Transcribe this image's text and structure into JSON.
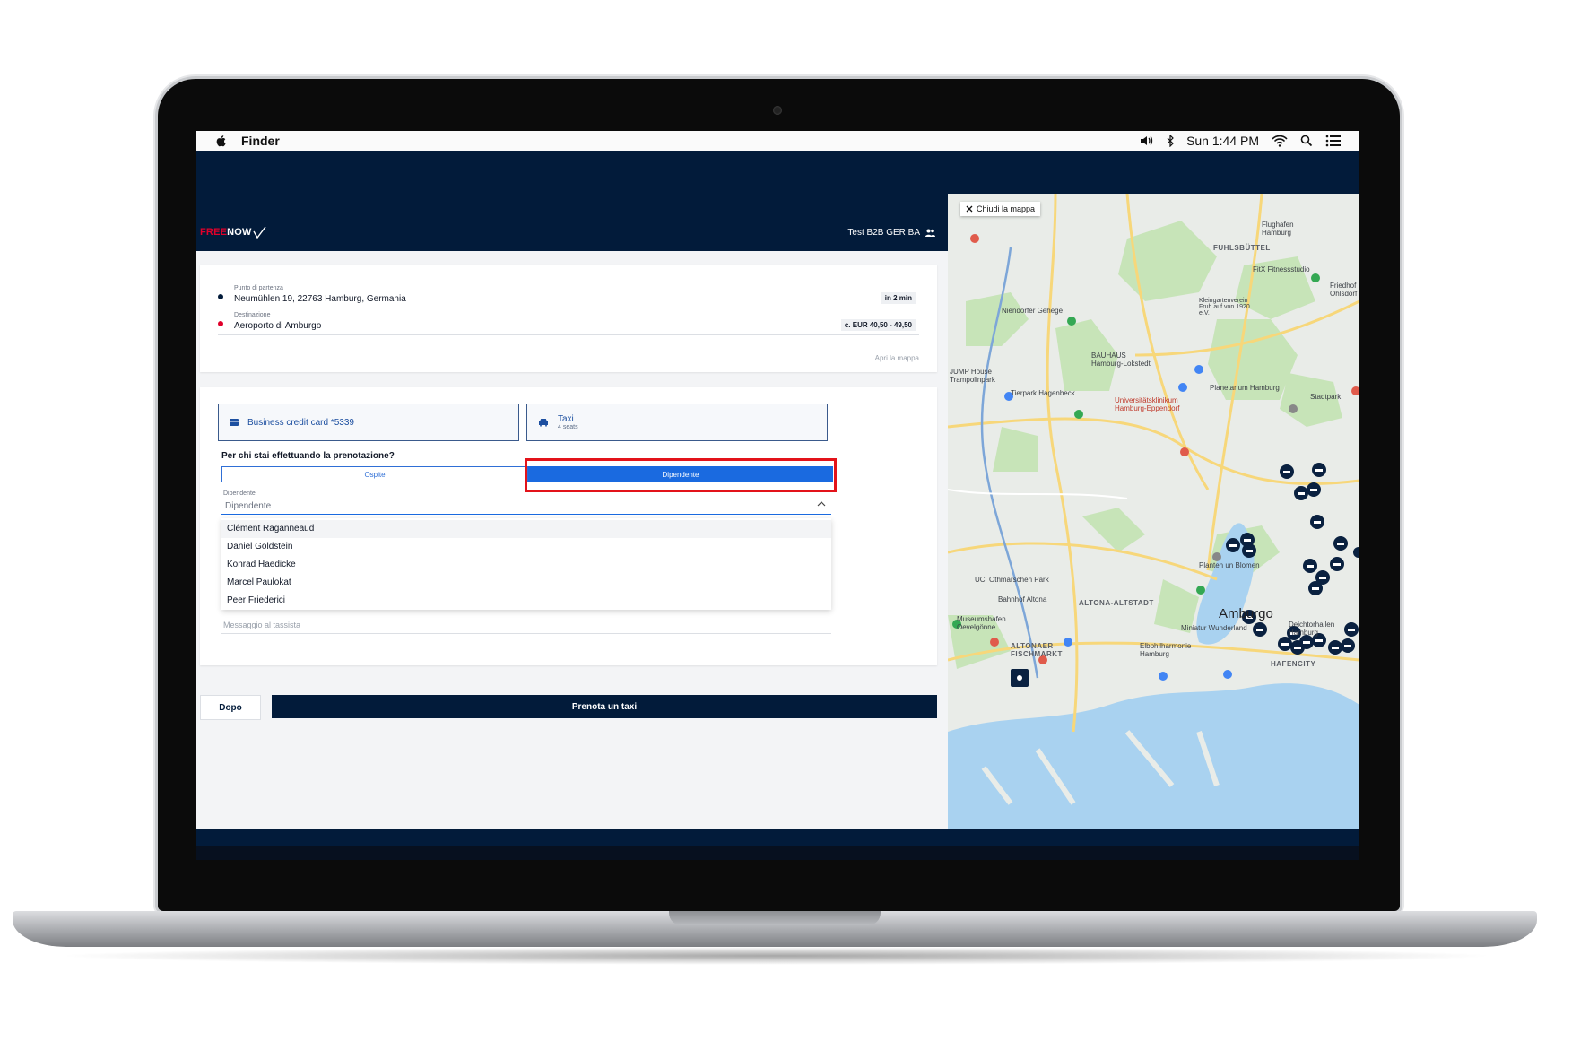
{
  "menubar": {
    "app": "Finder",
    "clock": "Sun 1:44 PM",
    "icons": [
      "apple-icon",
      "volume-icon",
      "bluetooth-icon",
      "wifi-icon",
      "search-icon",
      "list-icon"
    ]
  },
  "header": {
    "brand_free": "FREE",
    "brand_now": "NOW",
    "account": "Test B2B GER BA"
  },
  "route": {
    "pickup_label": "Punto di partenza",
    "pickup_value": "Neumühlen 19, 22763 Hamburg, Germania",
    "pickup_eta": "in 2 min",
    "dest_label": "Destinazione",
    "dest_value": "Aeroporto di Amburgo",
    "dest_price": "c. EUR 40,50 - 49,50",
    "open_map": "Apri la mappa"
  },
  "options": {
    "payment": "Business credit card *5339",
    "vehicle": "Taxi",
    "vehicle_seats": "4 seats",
    "question": "Per chi stai effettuando la prenotazione?",
    "segment_guest": "Ospite",
    "segment_employee": "Dipendente",
    "dropdown_label": "Dipendente",
    "dropdown_value": "Dipendente",
    "employees": [
      "Clément Raganneaud",
      "Daniel Goldstein",
      "Konrad Haedicke",
      "Marcel Paulokat",
      "Peer Friederici"
    ],
    "message_placeholder": "Messaggio al tassista"
  },
  "actions": {
    "later": "Dopo",
    "book": "Prenota un taxi"
  },
  "map": {
    "close": "Chiudi la mappa",
    "labels": {
      "fuhlsbuttel": "FUHLSBÜTTEL",
      "airport": "Flughafen Hamburg",
      "altona": "ALTONA-ALTSTADT",
      "city": "Amburgo",
      "hafencity": "HAFENCITY",
      "fischmarkt": "ALTONAER FISCHMARKT",
      "bauhaus": "BAUHAUS Hamburg-Lokstedt",
      "uke": "Universitätsklinikum Hamburg-Eppendorf",
      "hagenbeck": "Tierpark Hagenbeck",
      "niendorf": "Niendorfer Gehege",
      "planetarium": "Planetarium Hamburg",
      "stadtpark": "Stadtpark",
      "friedhof": "Friedhof Ohlsdorf",
      "fitx": "FitX Fitnessstudio",
      "elbphil": "Elbphilharmonie Hamburg",
      "miniatur": "Miniatur Wunderland",
      "dockhallen": "Deichtorhallen Hamburg",
      "planten": "Planten un Blomen",
      "othmarschen": "UCI Othmarschen Park",
      "museumshafen": "Museumshafen Oevelgönne",
      "bahnhof": "Bahnhof Altona",
      "jump": "JUMP House Trampolinpark",
      "kleingarten": "Kleingartenverein Fruh auf von 1920 e.V."
    },
    "colors": {
      "water": "#a9d2f0",
      "park": "#c7e4b8",
      "road": "#f7d77a"
    }
  }
}
